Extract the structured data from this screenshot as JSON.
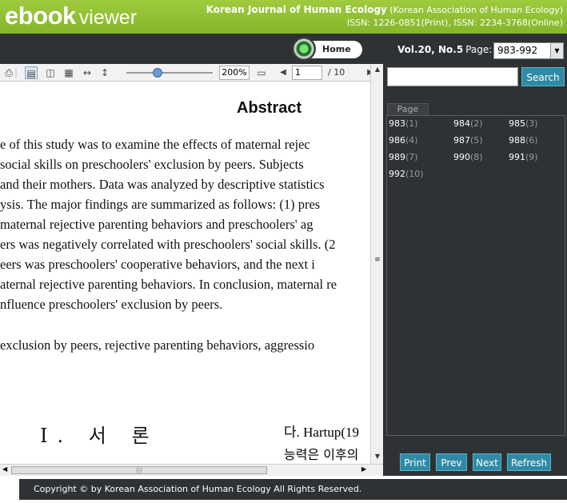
{
  "header": {
    "logo_bold": "ebook",
    "logo_light": "viewer",
    "journal_title": "Korean Journal of Human Ecology",
    "journal_org": "(Korean Association of Human Ecology)",
    "issn": "ISSN: 1226-0851(Print), ISSN: 2234-3768(Online)"
  },
  "nav": {
    "home_label": "Home",
    "vol_label": "Vol.20, No.5",
    "page_label": "Page:",
    "page_range": "983-992"
  },
  "toolbar": {
    "zoom": "200%",
    "page_current": "1",
    "page_total": "/ 10",
    "icons": [
      "print-icon",
      "single-page-icon",
      "two-page-icon",
      "thumbnails-icon",
      "fit-width-icon",
      "fit-height-icon",
      "fullscreen-icon"
    ]
  },
  "document": {
    "abstract_title": "Abstract",
    "lines": [
      "e of this study was to examine the effects of maternal rejec",
      " social skills on preschoolers' exclusion by peers. Subjects",
      "and their mothers. Data was analyzed by descriptive statistics",
      "ysis. The major findings are summarized as follows: (1) pres",
      " maternal rejective parenting behaviors and preschoolers' ag",
      "ers was negatively correlated with preschoolers' social skills. (2",
      "eers was preschoolers' cooperative behaviors, and the next i",
      "aternal rejective parenting behaviors. In conclusion, maternal re",
      "nfluence   preschoolers' exclusion by peers.",
      "exclusion by peers, rejective parenting behaviors, aggressio"
    ],
    "section_heading": "Ⅰ. 서 론",
    "right_line1": "다. Hartup(19",
    "right_line2": "능력은 이후의"
  },
  "panel": {
    "search_placeholder": "",
    "search_button": "Search",
    "page_tab": "Page",
    "pages": [
      {
        "num": "983",
        "idx": "(1)"
      },
      {
        "num": "984",
        "idx": "(2)"
      },
      {
        "num": "985",
        "idx": "(3)"
      },
      {
        "num": "986",
        "idx": "(4)"
      },
      {
        "num": "987",
        "idx": "(5)"
      },
      {
        "num": "988",
        "idx": "(6)"
      },
      {
        "num": "989",
        "idx": "(7)"
      },
      {
        "num": "990",
        "idx": "(8)"
      },
      {
        "num": "991",
        "idx": "(9)"
      },
      {
        "num": "992",
        "idx": "(10)"
      }
    ],
    "buttons": {
      "print": "Print",
      "prev": "Prev",
      "next": "Next",
      "refresh": "Refresh"
    }
  },
  "footer": {
    "copyright": "Copyright © by Korean Association of Human Ecology All Rights Reserved."
  }
}
